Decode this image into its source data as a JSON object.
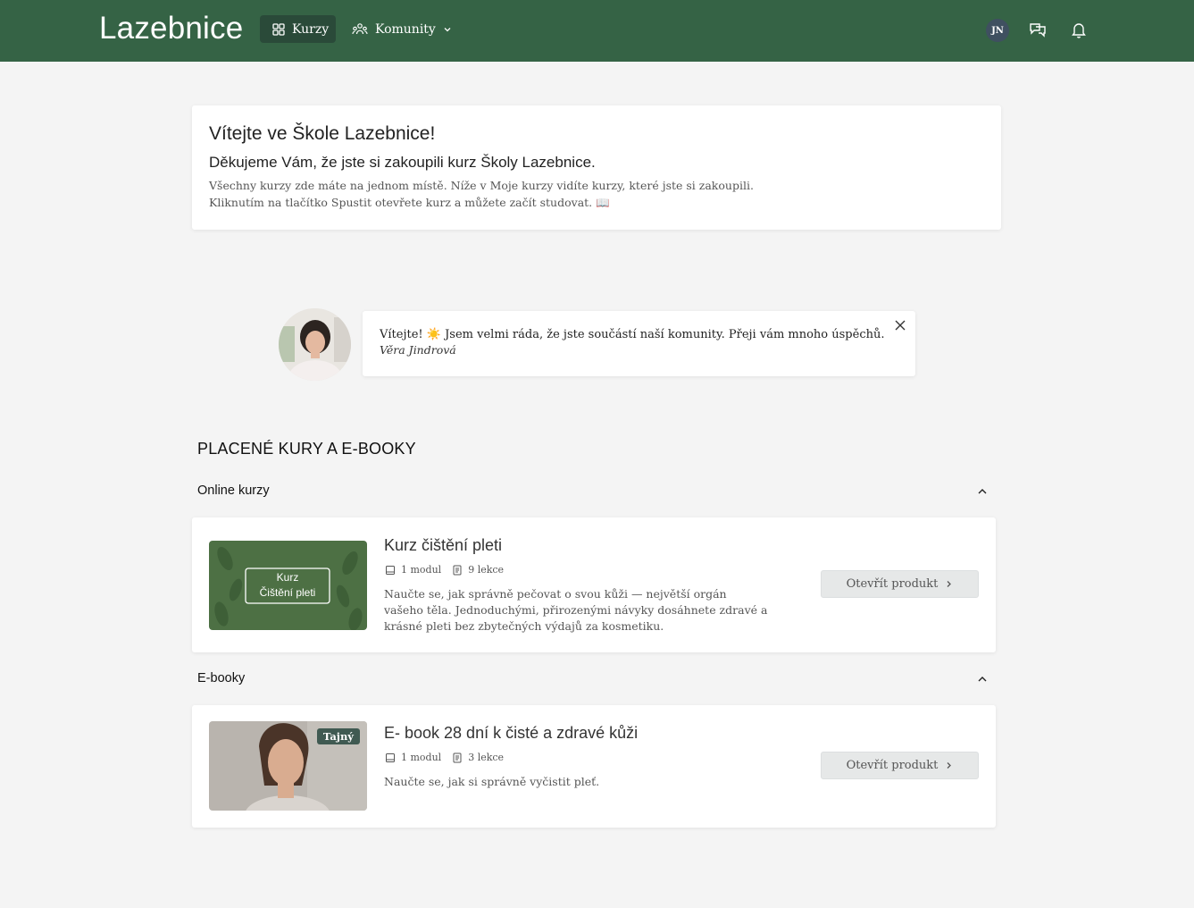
{
  "header": {
    "logo": "Lazebnice",
    "nav_kurzy": "Kurzy",
    "nav_komunity": "Komunity",
    "avatar_initials": "JN",
    "colors": {
      "bar": "#356345",
      "active": "#2a4a39"
    }
  },
  "welcome": {
    "title": "Vítejte ve Škole Lazebnice!",
    "subtitle": "Děkujeme Vám, že jste si zakoupili kurz Školy Lazebnice.",
    "text": "Všechny kurzy zde máte na jednom místě. Níže v Moje kurzy vidíte kurzy, které jste si zakoupili. Kliknutím na tlačítko Spustit otevřete kurz a můžete začít studovat. 📖"
  },
  "quote": {
    "text": "Vítejte! ☀️ Jsem velmi ráda, že jste součástí naší komunity. Přeji vám mnoho úspěchů.",
    "author": "Věra Jindrová"
  },
  "section": {
    "title": "PLACENÉ KURY A E-BOOKY",
    "categories": [
      {
        "name": "Online kurzy",
        "product": {
          "thumb_line1": "Kurz",
          "thumb_line2": "Čištění pleti",
          "title": "Kurz čištění pleti",
          "modules": "1 modul",
          "lessons": "9 lekce",
          "description": "Naučte se, jak správně pečovat o svou kůži — největší orgán vašeho těla. Jednoduchými, přirozenými návyky dosáhnete zdravé a krásné pleti bez zbytečných výdajů za kosmetiku.",
          "button": "Otevřít produkt"
        }
      },
      {
        "name": "E-booky",
        "product": {
          "badge": "Tajný",
          "title": "E- book 28 dní k čisté a zdravé kůži",
          "modules": "1 modul",
          "lessons": "3 lekce",
          "description": "Naučte se, jak si správně vyčistit pleť.",
          "button": "Otevřít produkt"
        }
      }
    ]
  }
}
